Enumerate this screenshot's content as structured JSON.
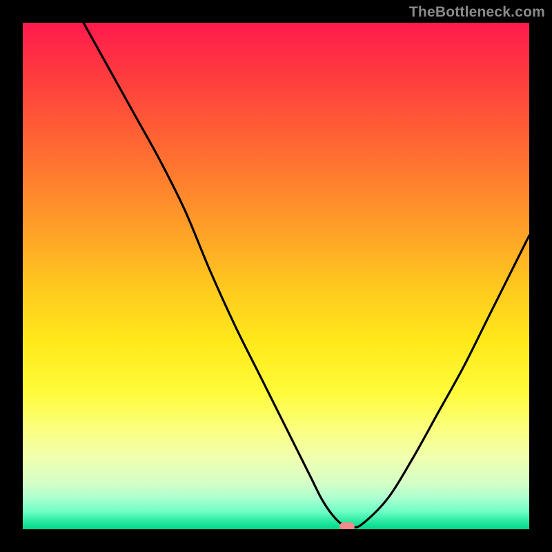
{
  "watermark": "TheBottleneck.com",
  "colors": {
    "frame": "#000000",
    "curve": "#000000",
    "marker": "#f48a8a",
    "watermark": "#8a8a8a"
  },
  "chart_data": {
    "type": "line",
    "title": "",
    "xlabel": "",
    "ylabel": "",
    "xlim": [
      0,
      100
    ],
    "ylim": [
      0,
      100
    ],
    "grid": false,
    "legend": false,
    "series": [
      {
        "name": "bottleneck-curve",
        "x": [
          12,
          17,
          22,
          27,
          32,
          37,
          42,
          47,
          52,
          55,
          57,
          59,
          61,
          63,
          65,
          67,
          72,
          77,
          82,
          87,
          92,
          97,
          100
        ],
        "values": [
          100,
          91,
          82,
          73,
          63,
          51,
          40,
          30,
          20,
          14,
          10,
          6,
          3,
          1,
          0.5,
          1,
          6,
          14,
          23,
          32,
          42,
          52,
          58
        ]
      }
    ],
    "marker": {
      "x": 64,
      "y": 0.5
    },
    "gradient_stops": [
      {
        "pos": 0,
        "color": "#ff1a4d"
      },
      {
        "pos": 10,
        "color": "#ff3a3f"
      },
      {
        "pos": 25,
        "color": "#ff6a32"
      },
      {
        "pos": 40,
        "color": "#ff9d28"
      },
      {
        "pos": 52,
        "color": "#ffc81f"
      },
      {
        "pos": 63,
        "color": "#ffe91a"
      },
      {
        "pos": 73,
        "color": "#fffb3a"
      },
      {
        "pos": 80,
        "color": "#fbff7d"
      },
      {
        "pos": 86,
        "color": "#f0ffb0"
      },
      {
        "pos": 91,
        "color": "#d4ffc8"
      },
      {
        "pos": 94,
        "color": "#a8ffd0"
      },
      {
        "pos": 96.5,
        "color": "#6effc4"
      },
      {
        "pos": 98.5,
        "color": "#28e8a0"
      },
      {
        "pos": 100,
        "color": "#00d88a"
      }
    ]
  }
}
